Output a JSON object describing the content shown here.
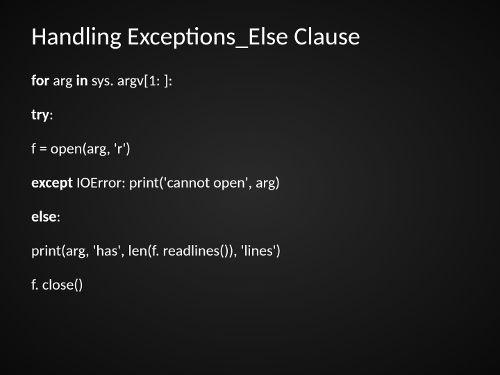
{
  "slide": {
    "title": "Handling Exceptions_Else Clause",
    "lines": {
      "l1_kw1": "for",
      "l1_txt1": " arg ",
      "l1_kw2": "in",
      "l1_txt2": " sys. argv[1: ]:",
      "l2_kw": "try",
      "l2_txt": ":",
      "l3_txt": "f = open(arg, 'r')",
      "l4_kw": " except",
      "l4_txt": " IOError: print('cannot open', arg)",
      "l5_kw": "else",
      "l5_txt": ":",
      "l6_txt": "print(arg, 'has', len(f. readlines()), 'lines')",
      "l7_txt": "f. close()"
    }
  }
}
